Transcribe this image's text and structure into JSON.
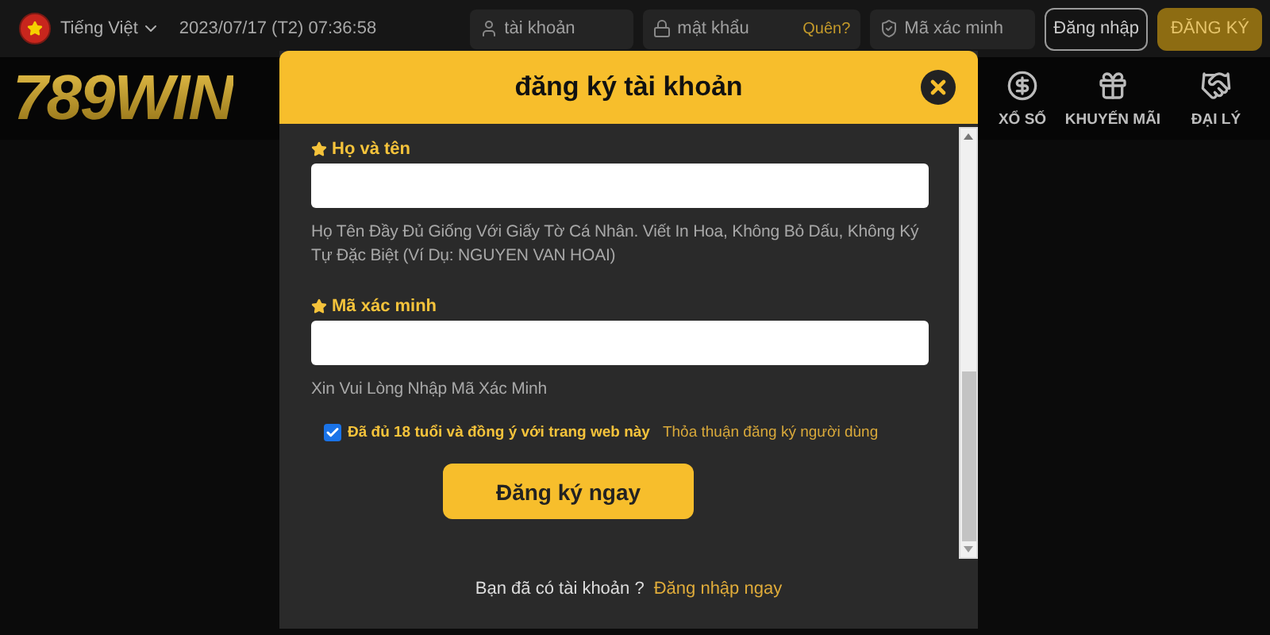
{
  "top_bar": {
    "language": "Tiếng Việt",
    "datetime": "2023/07/17 (T2) 07:36:58",
    "username": {
      "placeholder": "tài khoản"
    },
    "password": {
      "placeholder": "mật khẩu",
      "link": "Quên?"
    },
    "captcha": {
      "placeholder": "Mã xác minh"
    },
    "login_button": "Đăng nhập",
    "register_button": "ĐĂNG KÝ"
  },
  "nav": {
    "logo": "789WIN",
    "items": [
      {
        "label": "XỔ SỐ",
        "kind": "coin"
      },
      {
        "label": "KHUYẾN MÃI",
        "kind": "gift"
      },
      {
        "label": "ĐẠI LÝ",
        "kind": "handshake"
      }
    ]
  },
  "modal": {
    "title": "đăng ký tài khoản",
    "fields": [
      {
        "label": "Họ và tên",
        "hint": "Họ Tên Đầy Đủ Giống Với Giấy Tờ Cá Nhân. Viết In Hoa, Không Bỏ Dấu, Không Ký Tự Đặc Biệt (Ví Dụ: NGUYEN VAN HOAI)"
      },
      {
        "label": "Mã xác minh",
        "hint": "Xin Vui Lòng Nhập Mã Xác Minh"
      }
    ],
    "agree": {
      "checked": true,
      "label": "Đã đủ 18 tuổi và đồng ý với trang web này",
      "link": "Thỏa thuận đăng ký người dùng"
    },
    "submit": "Đăng ký ngay",
    "footer": {
      "text": "Bạn đã có tài khoản ?",
      "link": "Đăng nhập ngay"
    }
  }
}
